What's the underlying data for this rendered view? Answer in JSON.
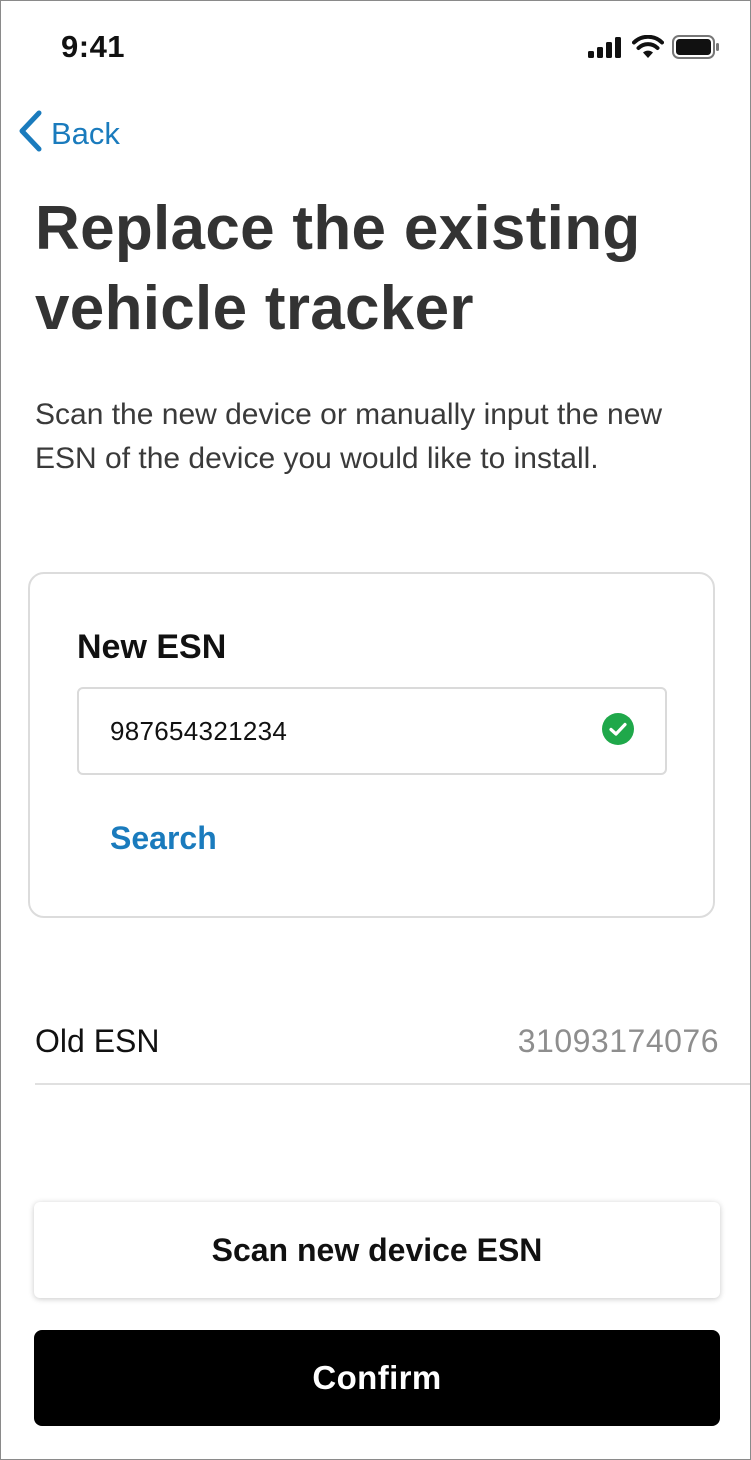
{
  "status_bar": {
    "time": "9:41",
    "icons": [
      "cellular-signal-icon",
      "wifi-icon",
      "battery-icon"
    ]
  },
  "nav": {
    "back_label": "Back",
    "back_icon": "chevron-left-icon"
  },
  "page": {
    "title": "Replace the existing vehicle tracker",
    "description": "Scan the new device or manually input the new ESN of the device you would like to install."
  },
  "new_esn_card": {
    "label": "New ESN",
    "value": "987654321234",
    "valid_icon": "check-circle-icon",
    "search_label": "Search"
  },
  "old_esn": {
    "label": "Old ESN",
    "value": "31093174076"
  },
  "actions": {
    "scan_label": "Scan new device ESN",
    "confirm_label": "Confirm"
  },
  "colors": {
    "accent": "#1a7bbd",
    "success": "#1fa84a",
    "title": "#333333",
    "muted": "#8e8e8e",
    "primary_button": "#000000"
  }
}
